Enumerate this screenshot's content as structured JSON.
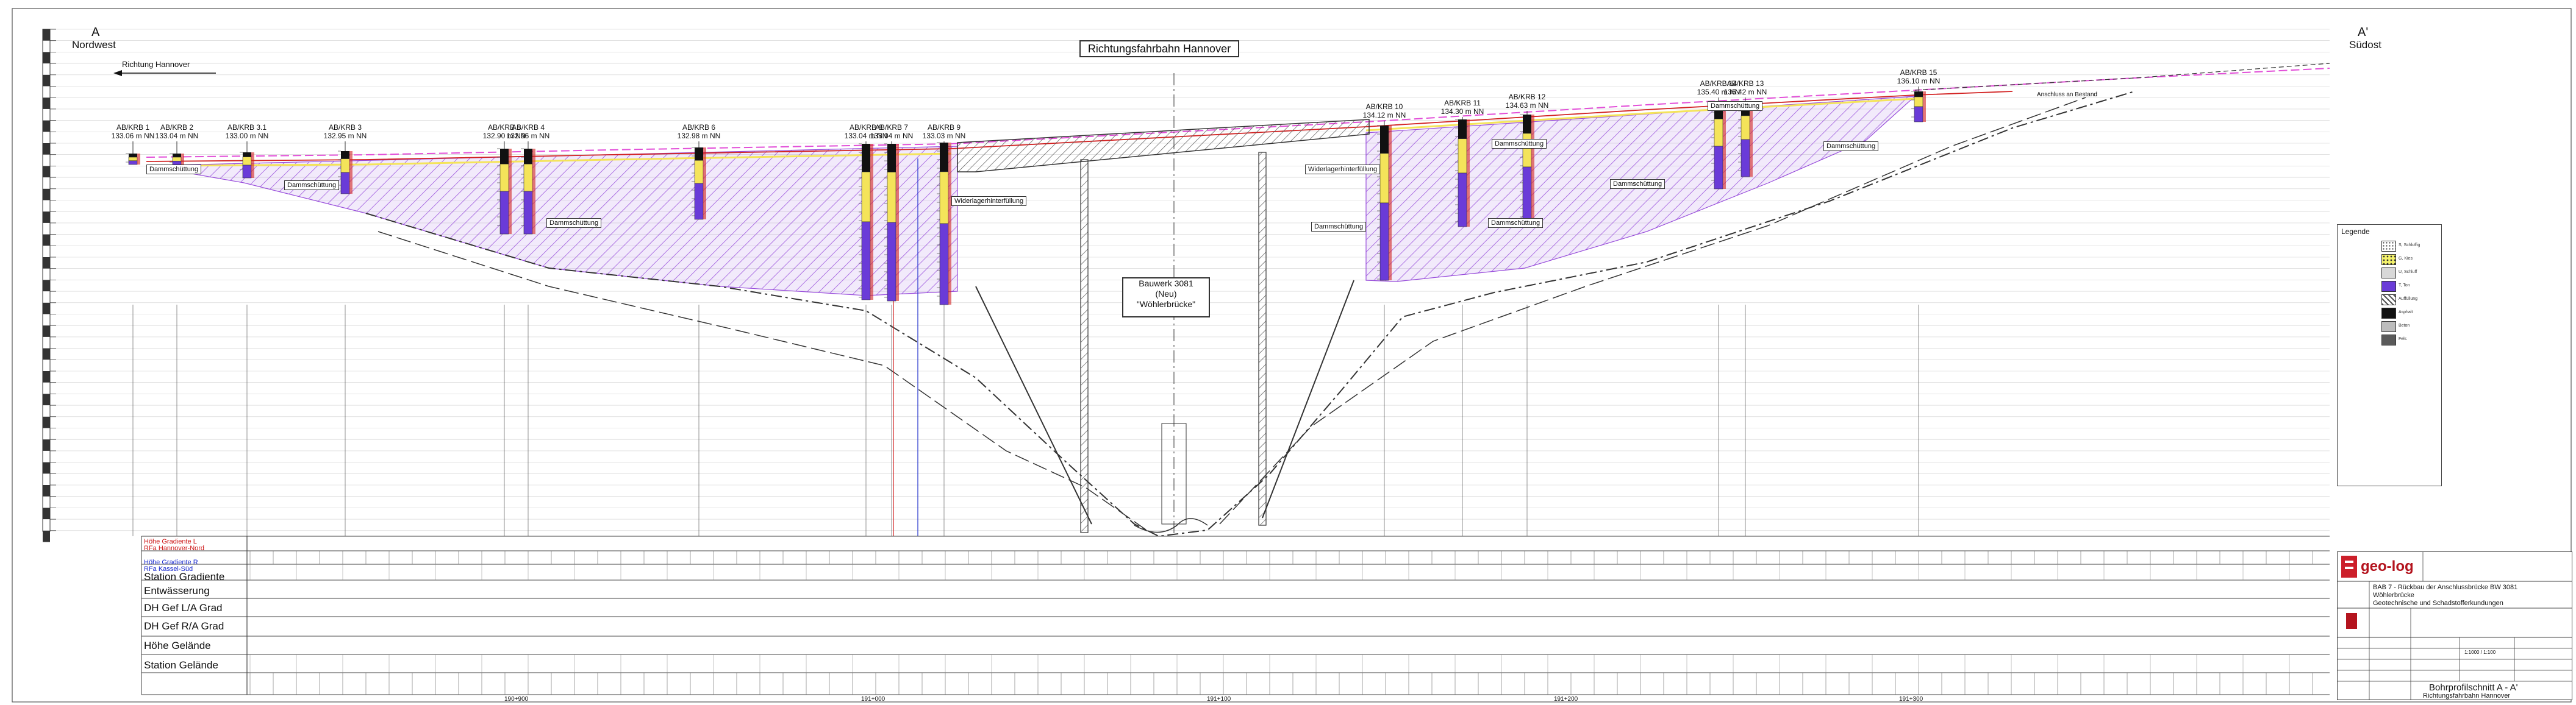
{
  "header": {
    "left_letter": "A",
    "left_direction": "Nordwest",
    "right_letter": "A'",
    "right_direction": "Südost",
    "direction_arrow_label": "Richtung Hannover",
    "main_title": "Richtungsfahrbahn Hannover"
  },
  "structure": {
    "line1": "Bauwerk 3081",
    "line2": "(Neu)",
    "line3": "\"Wöhlerbrücke\""
  },
  "boreholes": [
    {
      "name": "AB/KRB 1",
      "elev": "133.06 m NN"
    },
    {
      "name": "AB/KRB 2",
      "elev": "133.04 m NN"
    },
    {
      "name": "AB/KRB 3.1",
      "elev": "133.00 m NN"
    },
    {
      "name": "AB/KRB 3",
      "elev": "132.95 m NN"
    },
    {
      "name": "AB/KRB 5",
      "elev": "132.90 m NN"
    },
    {
      "name": "AB/KRB 4",
      "elev": "132.96 m NN"
    },
    {
      "name": "AB/KRB 6",
      "elev": "132.98 m NN"
    },
    {
      "name": "AB/KRB 8",
      "elev": "133.04 m NN"
    },
    {
      "name": "AB/KRB 7",
      "elev": "133.04 m NN"
    },
    {
      "name": "AB/KRB 9",
      "elev": "133.03 m NN"
    },
    {
      "name": "AB/KRB 10",
      "elev": "134.12 m NN"
    },
    {
      "name": "AB/KRB 11",
      "elev": "134.30 m NN"
    },
    {
      "name": "AB/KRB 12",
      "elev": "134.63 m NN"
    },
    {
      "name": "AB/KRB 14",
      "elev": "135.40 m NN"
    },
    {
      "name": "AB/KRB 13",
      "elev": "135.42 m NN"
    },
    {
      "name": "AB/KRB 15",
      "elev": "136.10 m NN"
    }
  ],
  "labels": {
    "dammschuettung": "Dammschüttung",
    "widerlager": "Widerlagerhinterfüllung",
    "anschluss": "Anschluss an Bestand"
  },
  "band_rows": [
    {
      "label": "Höhe Gradiente L",
      "sub": "RFa Hannover-Nord",
      "color": "#cc1111"
    },
    {
      "label": "Höhe Gradiente R",
      "sub": "RFa Kassel-Süd",
      "color": "#1122cc"
    },
    {
      "label": "Station Gradiente",
      "sub": "",
      "color": "#111"
    },
    {
      "label": "Entwässerung",
      "sub": "",
      "color": "#111"
    },
    {
      "label": "DH Gef L/A Grad",
      "sub": "",
      "color": "#111"
    },
    {
      "label": "DH Gef R/A Grad",
      "sub": "",
      "color": "#111"
    },
    {
      "label": "Höhe Gelände",
      "sub": "",
      "color": "#111"
    },
    {
      "label": "Station Gelände",
      "sub": "",
      "color": "#111"
    }
  ],
  "stations": [
    "190+900",
    "191+000",
    "191+100",
    "191+200",
    "191+300"
  ],
  "legend": {
    "title": "Legende",
    "items": [
      {
        "label": "S, Schluffig",
        "color": "#ffffff",
        "pattern": "dots"
      },
      {
        "label": "G, Kies",
        "color": "#f4f26a",
        "pattern": "gravel"
      },
      {
        "label": "U, Schluff",
        "color": "#d8d8d8",
        "pattern": "plain"
      },
      {
        "label": "T, Ton",
        "color": "#6a3bd8",
        "pattern": "plain"
      },
      {
        "label": "Auffüllung",
        "color": "#8a8a8a",
        "pattern": "hatch"
      },
      {
        "label": "Asphalt",
        "color": "#111111",
        "pattern": "plain"
      },
      {
        "label": "Beton",
        "color": "#bdbdbd",
        "pattern": "plain"
      },
      {
        "label": "Fels",
        "color": "#5a5a5a",
        "pattern": "plain"
      }
    ]
  },
  "title_block": {
    "company": "geo-log",
    "project": "BAB 7 - Rückbau der Anschlussbrücke BW 3081",
    "project_line2": "Wöhlerbrücke",
    "project_line3": "Geotechnische und Schadstofferkundungen",
    "drawing_title": "Bohrprofilschnitt A - A'",
    "drawing_sub": "Richtungsfahrbahn Hannover",
    "scale": "1:1000 / 1:100"
  },
  "colors": {
    "dam_fill": "#9a3fe0",
    "road": "#d22222",
    "road2": "#f08be0",
    "gravel": "#f4e45a",
    "ground": "#333333"
  }
}
